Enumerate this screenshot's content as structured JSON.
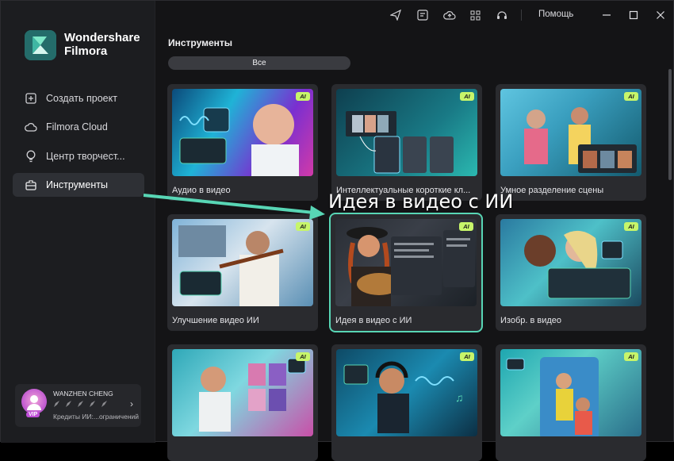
{
  "app": {
    "name_line1": "Wondershare",
    "name_line2": "Filmora"
  },
  "sidebar": {
    "items": [
      {
        "label": "Создать проект",
        "icon": "plus-square-icon"
      },
      {
        "label": "Filmora Cloud",
        "icon": "cloud-icon"
      },
      {
        "label": "Центр творчест...",
        "icon": "lightbulb-icon"
      },
      {
        "label": "Инструменты",
        "icon": "toolbox-icon",
        "active": true
      }
    ],
    "user": {
      "name": "WANZHEN CHENG",
      "credits": "Кредиты ИИ:...ограничений",
      "badge": "VIP"
    }
  },
  "topbar": {
    "icons": [
      "send-icon",
      "media-icon",
      "cloud-upload-icon",
      "grid-icon",
      "headset-icon"
    ],
    "help_label": "Помощь"
  },
  "main": {
    "section_title": "Инструменты",
    "filter_all": "Все",
    "cards": [
      {
        "label": "Аудио в видео",
        "ai": "AI"
      },
      {
        "label": "Интеллектуальные короткие кл...",
        "ai": "AI"
      },
      {
        "label": "Умное разделение сцены",
        "ai": "AI"
      },
      {
        "label": "Улучшение видео ИИ",
        "ai": "AI"
      },
      {
        "label": "Идея в видео с ИИ",
        "ai": "AI"
      },
      {
        "label": "Изобр. в видео",
        "ai": "AI"
      },
      {
        "label": "",
        "ai": "AI"
      },
      {
        "label": "",
        "ai": "AI"
      },
      {
        "label": "",
        "ai": "AI"
      }
    ]
  },
  "annotation": {
    "text": "Идея в видео с ИИ",
    "color": "#58d6b5"
  }
}
